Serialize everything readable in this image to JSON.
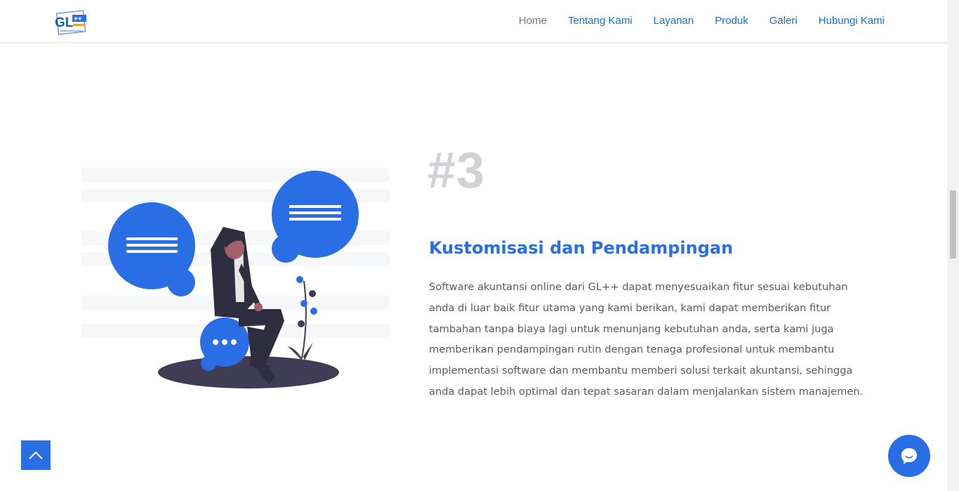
{
  "header": {
    "logo_text": "GL++",
    "nav": [
      {
        "label": "Home",
        "active": true
      },
      {
        "label": "Tentang Kami",
        "active": false
      },
      {
        "label": "Layanan",
        "active": false
      },
      {
        "label": "Produk",
        "active": false
      },
      {
        "label": "Galeri",
        "active": false
      },
      {
        "label": "Hubungi Kami",
        "active": false
      }
    ]
  },
  "feature": {
    "number": "#3",
    "title": "Kustomisasi dan Pendampingan",
    "description": "Software akuntansi online dari GL++ dapat menyesuaikan fitur sesuai kebutuhan anda di luar baik fitur utama yang kami berikan, kami dapat memberikan fitur tambahan tanpa biaya lagi untuk menunjang kebutuhan anda, serta kami juga memberikan pendampingan rutin dengan tenaga profesional untuk membantu implementasi software dan membantu memberi solusi terkait akuntansi, sehingga anda dapat lebih optimal dan tepat sasaran dalam menjalankan sistem manajemen."
  },
  "floating": {
    "back_to_top_icon": "chevron-up-icon",
    "chat_icon": "chat-bubble-icon"
  },
  "colors": {
    "accent": "#2a6ee6",
    "nav_link": "#1a6fc4",
    "nav_active": "#777777",
    "number": "#d0d2d5",
    "text": "#5a5a5a"
  }
}
